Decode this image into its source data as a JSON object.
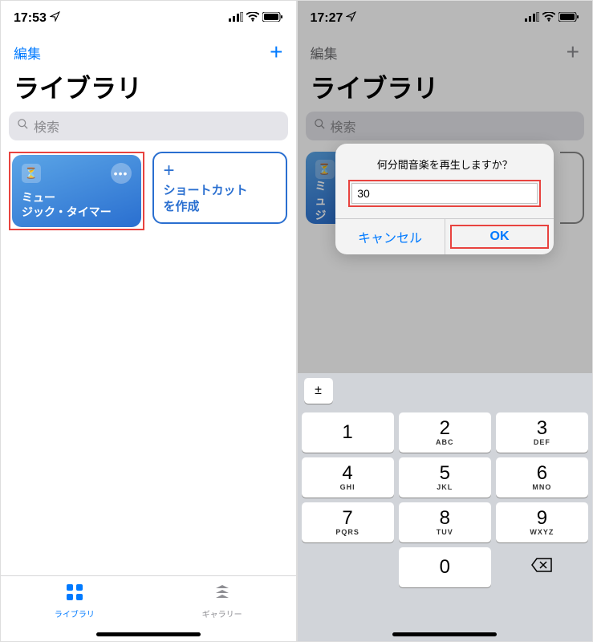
{
  "left": {
    "status_time": "17:53",
    "edit": "編集",
    "title": "ライブラリ",
    "search_placeholder": "検索",
    "shortcut_card": {
      "label_line1": "ミュー",
      "label_line2": "ジック・タイマー"
    },
    "create_card": {
      "label_line1": "ショートカット",
      "label_line2": "を作成"
    },
    "tabs": {
      "library": "ライブラリ",
      "gallery": "ギャラリー"
    }
  },
  "right": {
    "status_time": "17:27",
    "edit": "編集",
    "title": "ライブラリ",
    "search_placeholder": "検索",
    "shortcut_card_partial1": "ミュ",
    "shortcut_card_partial2": "ジッ",
    "alert": {
      "title": "何分間音楽を再生しますか？",
      "input_value": "30",
      "cancel": "キャンセル",
      "ok": "OK"
    },
    "keypad": {
      "pm": "±",
      "keys": [
        {
          "num": "1",
          "sub": ""
        },
        {
          "num": "2",
          "sub": "ABC"
        },
        {
          "num": "3",
          "sub": "DEF"
        },
        {
          "num": "4",
          "sub": "GHI"
        },
        {
          "num": "5",
          "sub": "JKL"
        },
        {
          "num": "6",
          "sub": "MNO"
        },
        {
          "num": "7",
          "sub": "PQRS"
        },
        {
          "num": "8",
          "sub": "TUV"
        },
        {
          "num": "9",
          "sub": "WXYZ"
        },
        {
          "num": "",
          "sub": ""
        },
        {
          "num": "0",
          "sub": ""
        },
        {
          "num": "",
          "sub": ""
        }
      ]
    }
  }
}
